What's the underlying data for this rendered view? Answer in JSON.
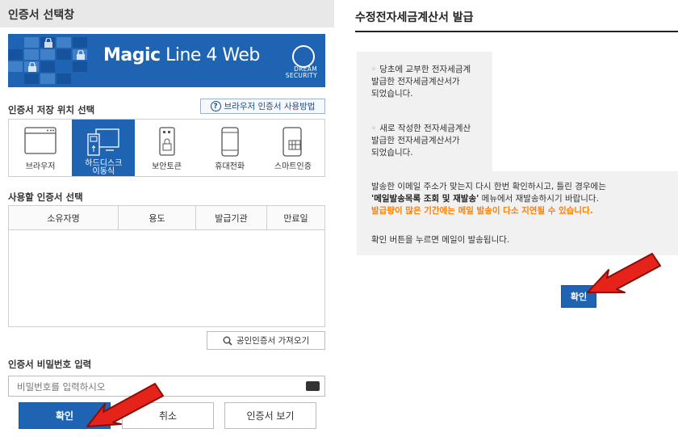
{
  "cert_dialog": {
    "title": "인증서 선택창",
    "banner": {
      "product_bold": "Magic",
      "product_thin": " Line 4 Web",
      "brand_line1": "DREAM",
      "brand_line2": "SECURITY"
    },
    "storage_section_label": "인증서 저장 위치 선택",
    "help_button_label": "브라우저 인증서 사용방법",
    "storage_options": [
      {
        "label": "브라우저",
        "icon": "browser-icon"
      },
      {
        "label": "하드디스크\n이동식",
        "icon": "harddisk-usb-icon",
        "selected": true
      },
      {
        "label": "보안토큰",
        "icon": "security-token-icon"
      },
      {
        "label": "휴대전화",
        "icon": "mobile-phone-icon"
      },
      {
        "label": "스마트인증",
        "icon": "smart-auth-icon"
      }
    ],
    "use_section_label": "사용할 인증서 선택",
    "table_columns": [
      "소유자명",
      "용도",
      "발급기관",
      "만료일"
    ],
    "import_button_label": "공인인증서 가져오기",
    "password_section_label": "인증서 비밀번호 입력",
    "password_placeholder": "비밀번호를 입력하시오",
    "ok_label": "확인",
    "cancel_label": "취소",
    "view_cert_label": "인증서 보기"
  },
  "invoice_panel": {
    "title": "수정전자세금계산서 발급",
    "notice_1_line1": "당초에 교부한 전자세금계",
    "notice_1_line2": "발급한 전자세금계산서가",
    "notice_1_line3": "되었습니다.",
    "notice_2_line1": "새로 작성한 전자세금계산",
    "notice_2_line2": "발급한 전자세금계산서가",
    "notice_2_line3": "되었습니다.",
    "email_check_text": "발송한 이메일 주소가 맞는지 다시 한번 확인하시고, 틀린 경우에는",
    "resend_menu": "'메일발송목록 조회 및 재발송'",
    "resend_suffix": " 메뉴에서 재발송하시기 바랍니다.",
    "delay_warning": "발급량이 많은 기간에는 메일 발송이 다소 지연될 수 있습니다.",
    "confirm_instruction": "확인 버튼을 누르면 메일이 발송됩니다.",
    "ok_label": "확인"
  },
  "colors": {
    "brand_blue": "#1f63b3",
    "warning_orange": "#ff7f00",
    "pointer_arrow": "#e5231b"
  }
}
